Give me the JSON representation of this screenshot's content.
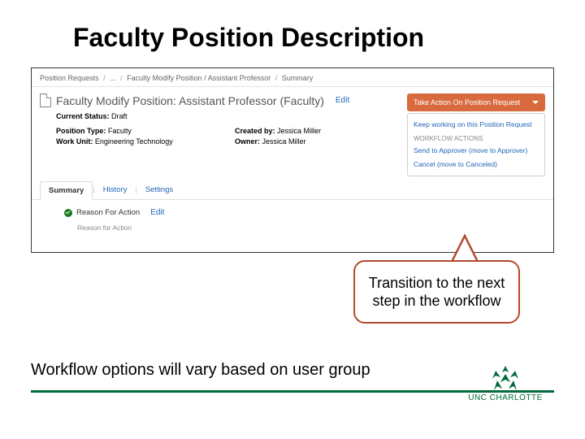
{
  "slide": {
    "title": "Faculty Position Description",
    "footer_note": "Workflow options will vary based on user group",
    "callout": "Transition to the next step in the workflow",
    "logo_text": "UNC CHARLOTTE"
  },
  "breadcrumb": {
    "a": "Position Requests",
    "b": "...",
    "c": "Faculty Modify Position / Assistant Professor",
    "d": "Summary"
  },
  "doc": {
    "title": "Faculty Modify Position: Assistant Professor (Faculty)",
    "edit": "Edit",
    "status_label": "Current Status:",
    "status_value": "Draft"
  },
  "meta": {
    "pos_type_label": "Position Type:",
    "pos_type_value": "Faculty",
    "created_by_label": "Created by:",
    "created_by_value": "Jessica Miller",
    "work_unit_label": "Work Unit:",
    "work_unit_value": "Engineering Technology",
    "owner_label": "Owner:",
    "owner_value": "Jessica Miller"
  },
  "actions": {
    "button": "Take Action On Position Request",
    "item_keep": "Keep working on this Position Request",
    "section_label": "WORKFLOW ACTIONS",
    "item_send": "Send to Approver (move to Approver)",
    "item_cancel": "Cancel (move to Canceled)"
  },
  "tabs": {
    "summary": "Summary",
    "history": "History",
    "settings": "Settings"
  },
  "section": {
    "title": "Reason For Action",
    "edit": "Edit",
    "sub": "Reason for Action"
  }
}
